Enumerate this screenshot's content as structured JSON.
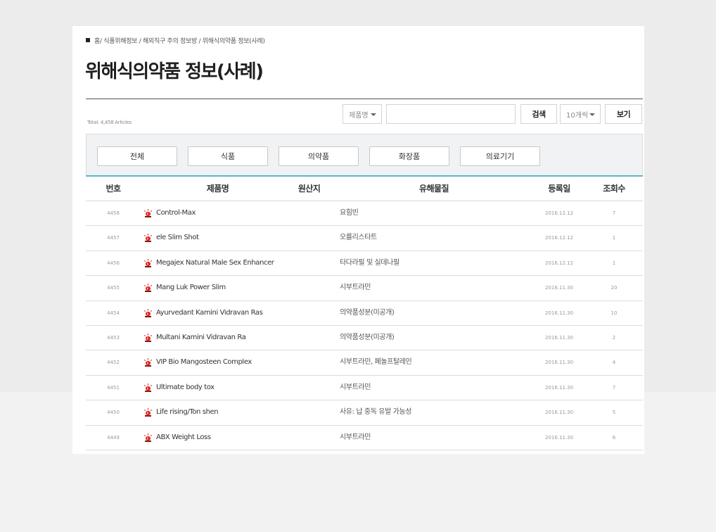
{
  "breadcrumb": {
    "home": "홈",
    "path": " / 식품위해정보 / 해외직구 주의 정보방 / 위해식의약품 정보(사례)"
  },
  "page_title": "위해식의약품 정보(사례)",
  "total": "Total: 4,458 Articles",
  "search": {
    "field_select": "제품명",
    "input_value": "",
    "search_button": "검색",
    "count_select": "10개씩",
    "view_button": "보기"
  },
  "filters": [
    "전체",
    "식품",
    "의약품",
    "화장품",
    "의료기기"
  ],
  "table": {
    "headers": [
      "번호",
      "제품명",
      "원산지",
      "유해물질",
      "등록일",
      "조회수"
    ],
    "rows": [
      {
        "num": "4458",
        "name": "Control-Max",
        "substance": "요힘빈",
        "date": "2016.12.12",
        "views": "7"
      },
      {
        "num": "4457",
        "name": "ele Slim Shot",
        "substance": "오를리스타트",
        "date": "2016.12.12",
        "views": "1"
      },
      {
        "num": "4456",
        "name": "Megajex Natural Male Sex Enhancer",
        "substance": "타다라필 및 실데나필",
        "date": "2016.12.12",
        "views": "1"
      },
      {
        "num": "4455",
        "name": "Mang Luk Power Slim",
        "substance": "시부트라민",
        "date": "2016.11.30",
        "views": "20"
      },
      {
        "num": "4454",
        "name": "Ayurvedant Kamini Vidravan Ras",
        "substance": "의약품성분(미공개)",
        "date": "2016.11.30",
        "views": "10"
      },
      {
        "num": "4453",
        "name": "Multani Kamini Vidravan Ra",
        "substance": "의약품성분(미공개)",
        "date": "2016.11.30",
        "views": "2"
      },
      {
        "num": "4452",
        "name": "VIP Bio Mangosteen Complex",
        "substance": "시부트라민, 페놀프탈레인",
        "date": "2016.11.30",
        "views": "4"
      },
      {
        "num": "4451",
        "name": "Ultimate body tox",
        "substance": "시부트라민",
        "date": "2016.11.30",
        "views": "7"
      },
      {
        "num": "4450",
        "name": "Life rising/Ton shen",
        "substance": "사유: 납 중독 유발 가능성",
        "date": "2016.11.30",
        "views": "5"
      },
      {
        "num": "4449",
        "name": "ABX Weight Loss",
        "substance": "시부트라민",
        "date": "2016.11.30",
        "views": "6"
      }
    ]
  },
  "colors": {
    "accent_line": "#59b5c9",
    "siren_icon": "#d9231f",
    "filter_bg": "#f1f2f3"
  }
}
